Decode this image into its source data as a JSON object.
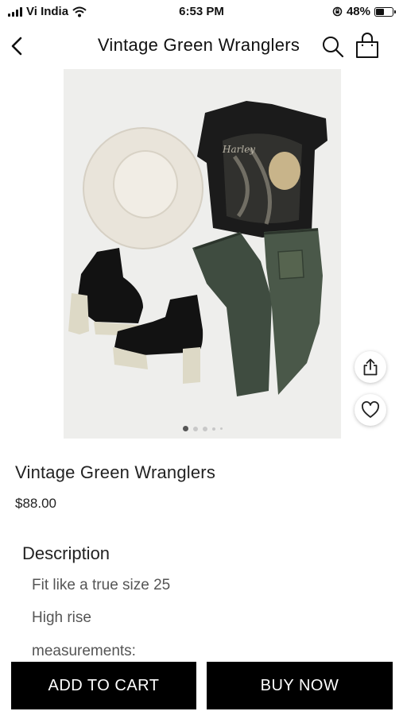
{
  "status_bar": {
    "carrier": "Vi India",
    "time": "6:53 PM",
    "battery": "48%",
    "battery_level": 0.48
  },
  "header": {
    "title": "Vintage Green Wranglers",
    "back_icon": "chevron-left-icon",
    "search_icon": "search-icon",
    "bag_icon": "shopping-bag-icon"
  },
  "gallery": {
    "image_count": 5,
    "active_index": 0,
    "share_icon": "share-icon",
    "wishlist_icon": "heart-icon"
  },
  "product": {
    "name": "Vintage Green Wranglers",
    "price": "$88.00"
  },
  "description": {
    "heading": "Description",
    "lines": [
      "Fit like a true size 25",
      "High rise",
      "measurements:"
    ]
  },
  "actions": {
    "add_to_cart": "ADD TO CART",
    "buy_now": "BUY NOW"
  },
  "colors": {
    "button_bg": "#000000",
    "button_text": "#ffffff"
  }
}
